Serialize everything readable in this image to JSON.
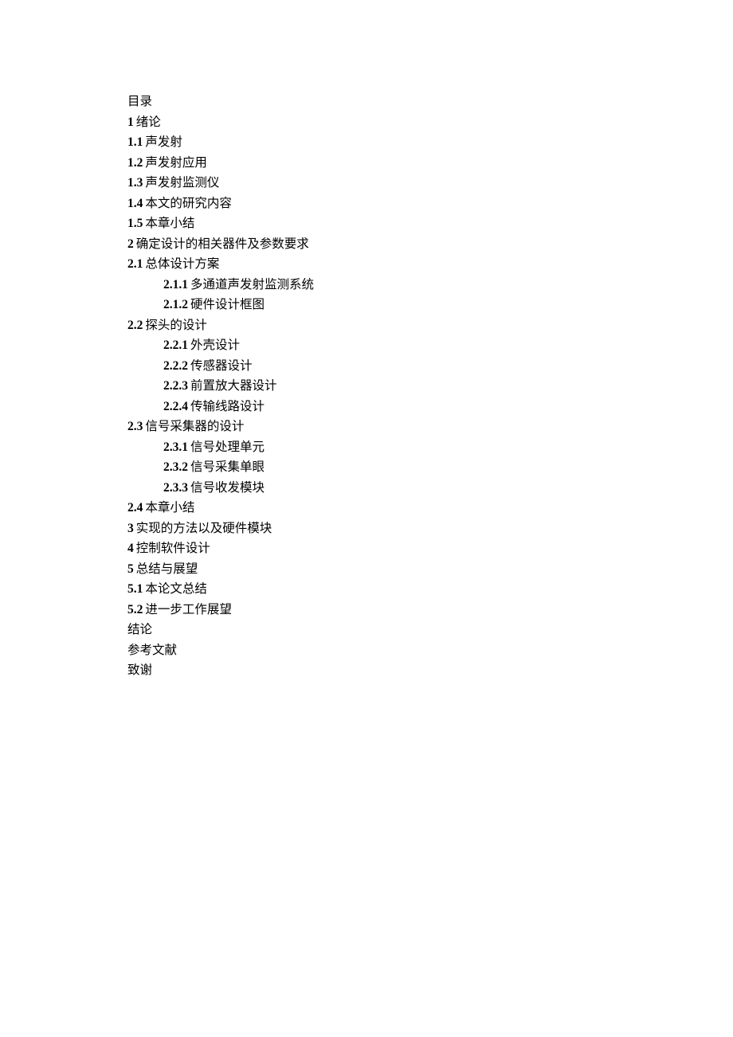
{
  "heading": "目录",
  "entries": [
    {
      "level": 1,
      "num": "1",
      "text": "绪论"
    },
    {
      "level": 2,
      "num": "1.1",
      "text": "声发射"
    },
    {
      "level": 2,
      "num": "1.2",
      "text": "声发射应用"
    },
    {
      "level": 2,
      "num": "1.3",
      "text": "声发射监测仪"
    },
    {
      "level": 2,
      "num": "1.4",
      "text": "本文的研究内容"
    },
    {
      "level": 2,
      "num": "1.5",
      "text": "本章小结"
    },
    {
      "level": 1,
      "num": "2",
      "text": "确定设计的相关器件及参数要求"
    },
    {
      "level": 2,
      "num": "2.1",
      "text": "总体设计方案"
    },
    {
      "level": 3,
      "num": "2.1.1",
      "text": "多通道声发射监测系统"
    },
    {
      "level": 3,
      "num": "2.1.2",
      "text": "硬件设计框图"
    },
    {
      "level": 2,
      "num": "2.2",
      "text": "探头的设计"
    },
    {
      "level": 3,
      "num": "2.2.1",
      "text": "外壳设计"
    },
    {
      "level": 3,
      "num": "2.2.2",
      "text": "传感器设计"
    },
    {
      "level": 3,
      "num": "2.2.3",
      "text": "前置放大器设计"
    },
    {
      "level": 3,
      "num": "2.2.4",
      "text": "传输线路设计"
    },
    {
      "level": 2,
      "num": "2.3",
      "text": "信号采集器的设计"
    },
    {
      "level": 3,
      "num": "2.3.1",
      "text": "信号处理单元"
    },
    {
      "level": 3,
      "num": "2.3.2",
      "text": "信号采集单眼"
    },
    {
      "level": 3,
      "num": "2.3.3",
      "text": "信号收发模块"
    },
    {
      "level": 2,
      "num": "2.4",
      "text": "本章小结"
    },
    {
      "level": 1,
      "num": "3",
      "text": "实现的方法以及硬件模块"
    },
    {
      "level": 1,
      "num": "4",
      "text": "控制软件设计"
    },
    {
      "level": 1,
      "num": "5",
      "text": "总结与展望"
    },
    {
      "level": 2,
      "num": "5.1",
      "text": "本论文总结"
    },
    {
      "level": 2,
      "num": "5.2",
      "text": "进一步工作展望"
    },
    {
      "level": 0,
      "num": "",
      "text": "结论"
    },
    {
      "level": 0,
      "num": "",
      "text": "参考文献"
    },
    {
      "level": 0,
      "num": "",
      "text": "致谢"
    }
  ]
}
